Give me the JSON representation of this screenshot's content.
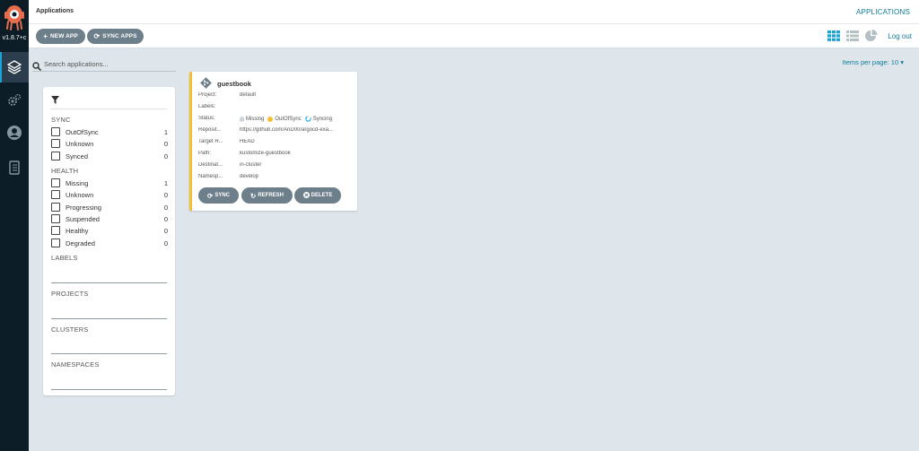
{
  "app": {
    "version": "v1.8.7+c",
    "page_title": "Applications",
    "top_link": "APPLICATIONS",
    "logout": "Log out"
  },
  "toolbar": {
    "new_app": "NEW APP",
    "sync_apps": "SYNC APPS",
    "view_modes": [
      "tiles-icon",
      "list-icon",
      "summary-pie-icon"
    ]
  },
  "search": {
    "placeholder": "Search applications..."
  },
  "pagination": {
    "items_per_page": "Items per page: 10"
  },
  "filters": {
    "sync": {
      "title": "SYNC",
      "items": [
        {
          "label": "OutOfSync",
          "count": "1"
        },
        {
          "label": "Unknown",
          "count": "0"
        },
        {
          "label": "Synced",
          "count": "0"
        }
      ]
    },
    "health": {
      "title": "HEALTH",
      "items": [
        {
          "label": "Missing",
          "count": "1"
        },
        {
          "label": "Unknown",
          "count": "0"
        },
        {
          "label": "Progressing",
          "count": "0"
        },
        {
          "label": "Suspended",
          "count": "0"
        },
        {
          "label": "Healthy",
          "count": "0"
        },
        {
          "label": "Degraded",
          "count": "0"
        }
      ]
    },
    "labels_title": "LABELS",
    "projects_title": "PROJECTS",
    "clusters_title": "CLUSTERS",
    "namespaces_title": "NAMESPACES"
  },
  "card": {
    "name": "guestbook",
    "fields": [
      {
        "key": "Project:",
        "value": "default"
      },
      {
        "key": "Labels:",
        "value": ""
      },
      {
        "key": "Status:",
        "value": ""
      },
      {
        "key": "Reposit...",
        "value": "https://github.com/AnD00/argocd-exa..."
      },
      {
        "key": "Target R...",
        "value": "HEAD"
      },
      {
        "key": "Path:",
        "value": "kustomize-guestbook"
      },
      {
        "key": "Destinat...",
        "value": "in-cluster"
      },
      {
        "key": "Namesp...",
        "value": "develop"
      }
    ],
    "status": {
      "health": "Missing",
      "sync": "OutOfSync",
      "operation": "Syncing"
    },
    "buttons": {
      "sync": "SYNC",
      "refresh": "REFRESH",
      "delete": "DELETE"
    }
  },
  "colors": {
    "sidebar": "#0d1d28",
    "accent": "#0f7b9c",
    "button": "#6d7f8b",
    "card_border": "#f4c030",
    "outofsync": "#f4c030",
    "syncing": "#0dadea"
  }
}
